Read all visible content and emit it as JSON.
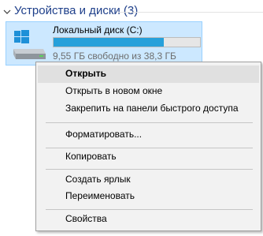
{
  "group": {
    "title": "Устройства и диски (3)",
    "chevron_icon": "chevron-down-icon"
  },
  "drive": {
    "icon": "windows-drive-icon",
    "name": "Локальный диск (C:)",
    "free_text": "9,55 ГБ свободно из 38,3 ГБ",
    "used_fraction": 0.75,
    "bar_color": "#26a0da"
  },
  "context_menu": {
    "items": [
      {
        "label": "Открыть"
      },
      {
        "label": "Открыть в новом окне"
      },
      {
        "label": "Закрепить на панели быстрого доступа"
      },
      {
        "label": "Форматировать..."
      },
      {
        "label": "Копировать"
      },
      {
        "label": "Создать ярлык"
      },
      {
        "label": "Переименовать"
      },
      {
        "label": "Свойства"
      }
    ]
  },
  "colors": {
    "group_title": "#1e3f8a",
    "selection_bg": "#cce8ff",
    "selection_border": "#99d1ff",
    "menu_bg": "#f2f2f2",
    "menu_hover": "#e0e0e0"
  }
}
